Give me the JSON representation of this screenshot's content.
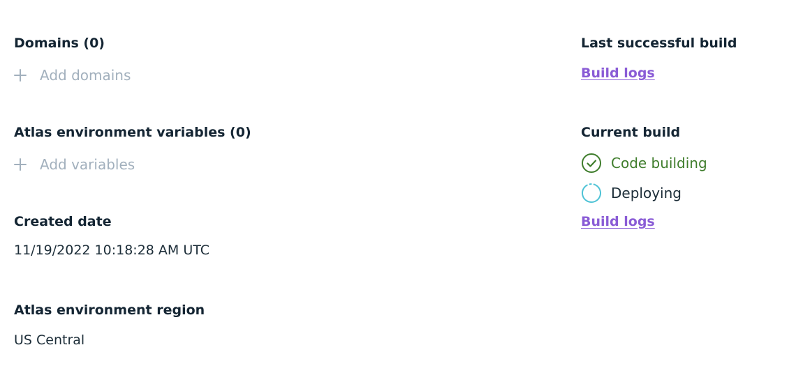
{
  "left": {
    "domains": {
      "heading": "Domains (0)",
      "add_label": "Add domains"
    },
    "env_vars": {
      "heading": "Atlas environment variables (0)",
      "add_label": "Add variables"
    },
    "created": {
      "heading": "Created date",
      "value": "11/19/2022 10:18:28 AM UTC"
    },
    "region": {
      "heading": "Atlas environment region",
      "value": "US Central"
    }
  },
  "right": {
    "last_build": {
      "heading": "Last successful build",
      "link": "Build logs"
    },
    "current_build": {
      "heading": "Current build",
      "steps": [
        {
          "label": "Code building",
          "state": "done",
          "icon": "check-circle-icon"
        },
        {
          "label": "Deploying",
          "state": "in-progress",
          "icon": "spinner-icon"
        }
      ],
      "link": "Build logs"
    }
  },
  "colors": {
    "heading": "#142533",
    "muted": "#a2b0bd",
    "link": "#8a5cd6",
    "success": "#3f7d2c",
    "spinner": "#4fc3d6"
  }
}
